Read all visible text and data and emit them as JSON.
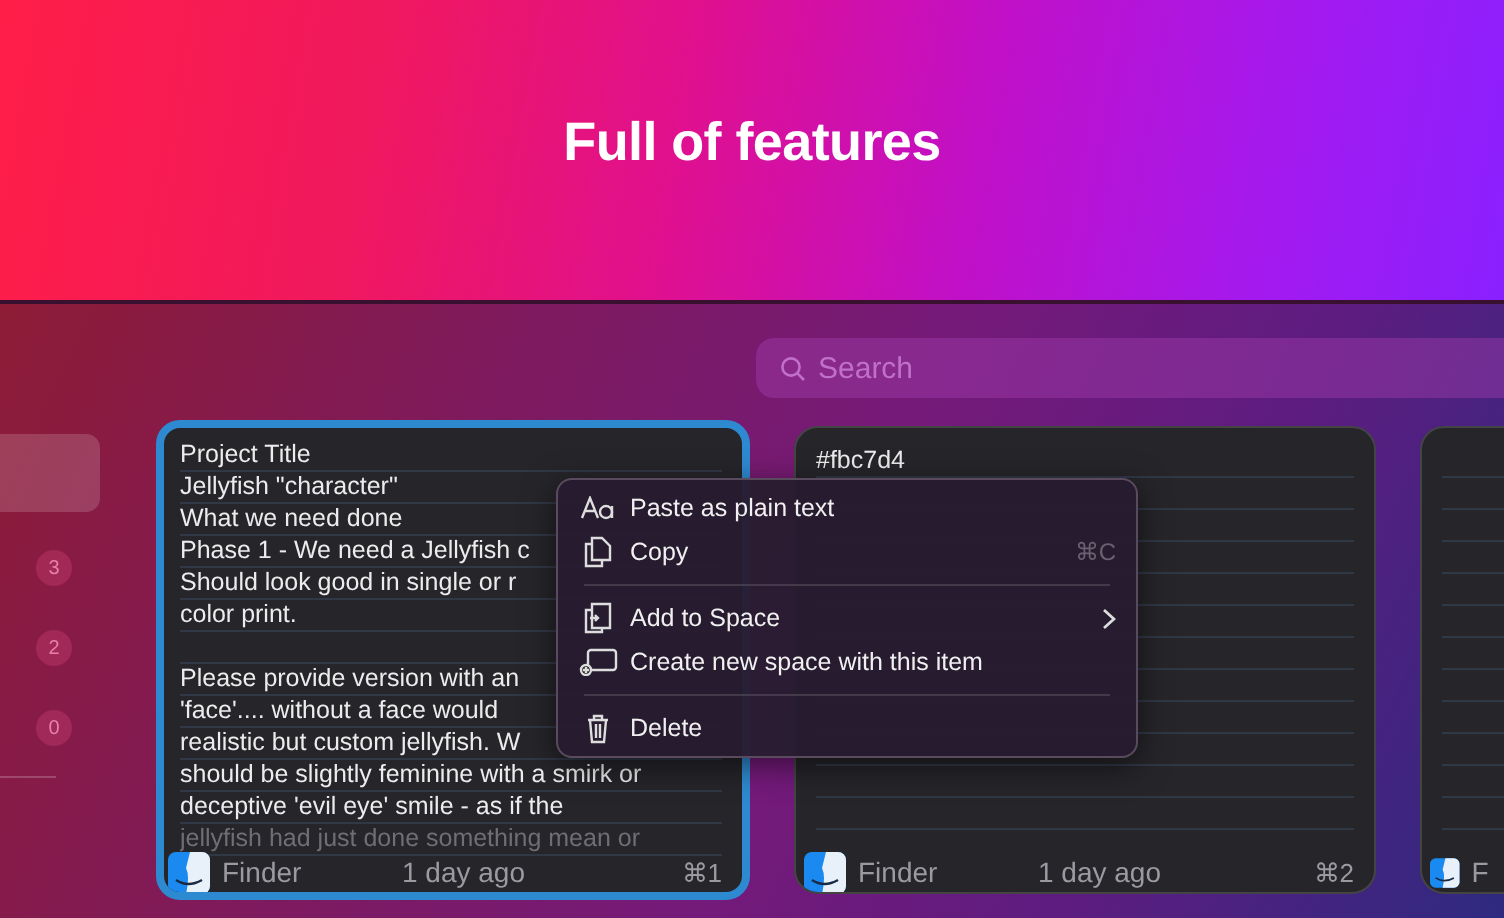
{
  "banner": {
    "title": "Full of features"
  },
  "sidebar": {
    "items": [
      {
        "selected": true
      },
      {
        "count": "3",
        "selected": false
      },
      {
        "count": "2",
        "selected": false
      },
      {
        "count": "0",
        "selected": false
      }
    ]
  },
  "search": {
    "placeholder": "Search"
  },
  "cards": [
    {
      "selected": true,
      "paragraphs": [
        [
          "Project Title",
          "Jellyfish \"character\"",
          "What we need done",
          "Phase 1 - We need a Jellyfish c",
          "Should look good in single or r",
          "color print."
        ],
        [
          "Please provide version with an",
          "'face'....   without a face would",
          "realistic but custom jellyfish. W",
          "should be slightly feminine with a smirk or",
          "deceptive 'evil eye' smile - as if the",
          "jellyfish had just done something mean or"
        ]
      ],
      "source": "Finder",
      "time": "1 day ago",
      "shortcut": "⌘1"
    },
    {
      "selected": false,
      "paragraphs": [
        [
          "#fbc7d4"
        ]
      ],
      "source": "Finder",
      "time": "1 day ago",
      "shortcut": "⌘2"
    },
    {
      "selected": false,
      "source": "F"
    }
  ],
  "context_menu": {
    "items": [
      {
        "kind": "item",
        "label": "Paste as plain text"
      },
      {
        "kind": "item",
        "label": "Copy",
        "shortcut": "⌘C"
      },
      {
        "kind": "separator"
      },
      {
        "kind": "item",
        "label": "Add to Space",
        "submenu": true
      },
      {
        "kind": "item",
        "label": "Create new space with this item"
      },
      {
        "kind": "separator"
      },
      {
        "kind": "item",
        "label": "Delete"
      }
    ]
  }
}
